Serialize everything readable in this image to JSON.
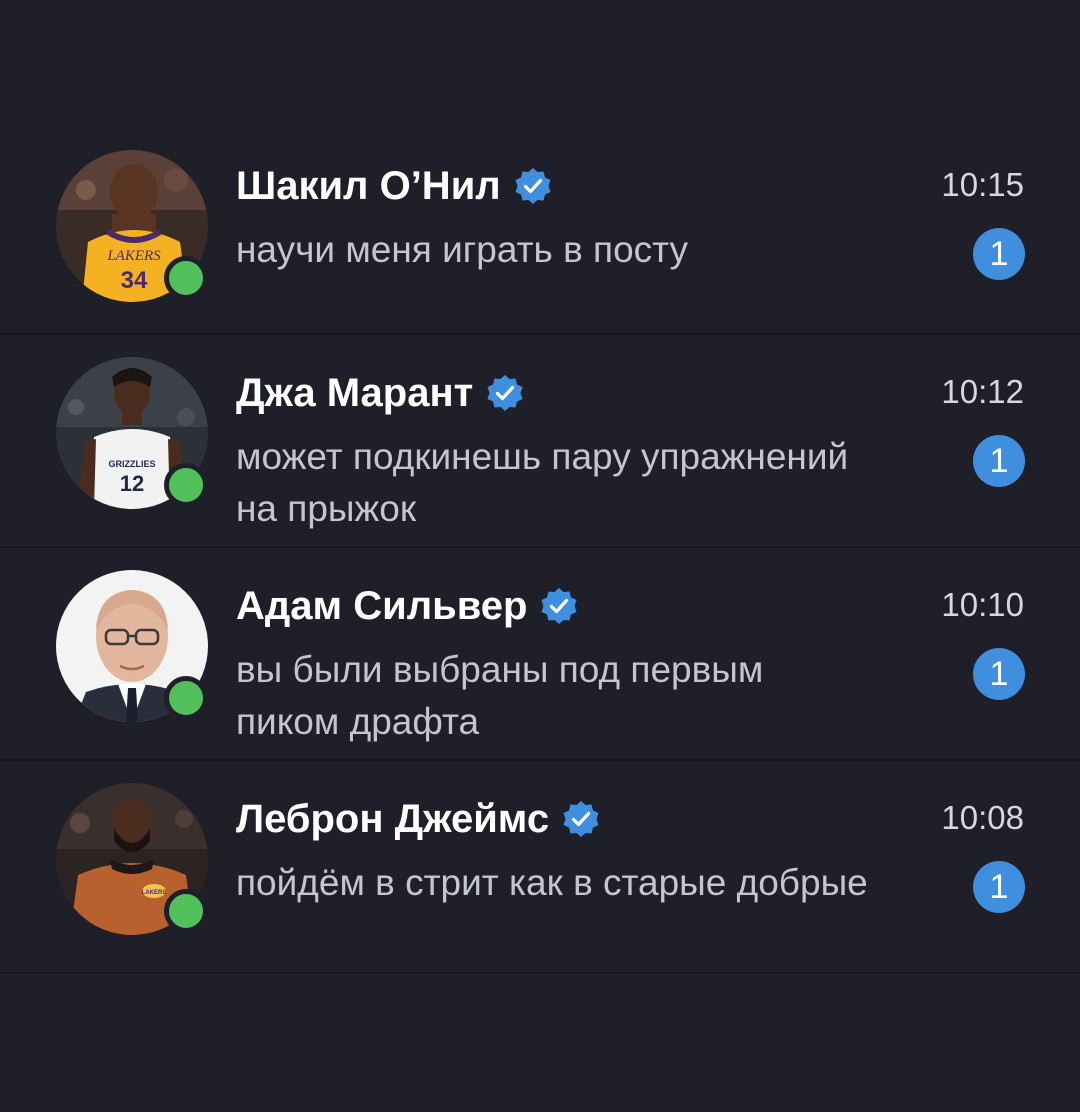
{
  "colors": {
    "background": "#1e1f28",
    "accent": "#3f8fde",
    "online": "#52c05b",
    "verified": "#3f8fde"
  },
  "chats": [
    {
      "name": "Шакил О’Нил",
      "message": "научи меня играть в посту",
      "time": "10:15",
      "unread": "1",
      "verified": true,
      "online": true,
      "avatar_icon": "shaquille-oneal-lakers-photo"
    },
    {
      "name": "Джа Марант",
      "message": "может подкинешь пару упражнений на прыжок",
      "time": "10:12",
      "unread": "1",
      "verified": true,
      "online": true,
      "avatar_icon": "ja-morant-grizzlies-photo"
    },
    {
      "name": "Адам Сильвер",
      "message": "вы были выбраны под первым пиком драфта",
      "time": "10:10",
      "unread": "1",
      "verified": true,
      "online": true,
      "avatar_icon": "adam-silver-photo"
    },
    {
      "name": "Леброн Джеймс",
      "message": "пойдём в стрит как в старые добрые",
      "time": "10:08",
      "unread": "1",
      "verified": true,
      "online": true,
      "avatar_icon": "lebron-james-photo"
    }
  ],
  "avatar_text": {
    "shaq_team": "LAKERS",
    "shaq_number": "34",
    "ja_team": "GRIZZLIES",
    "ja_number": "12",
    "lebron_logo": "LAKERS"
  }
}
